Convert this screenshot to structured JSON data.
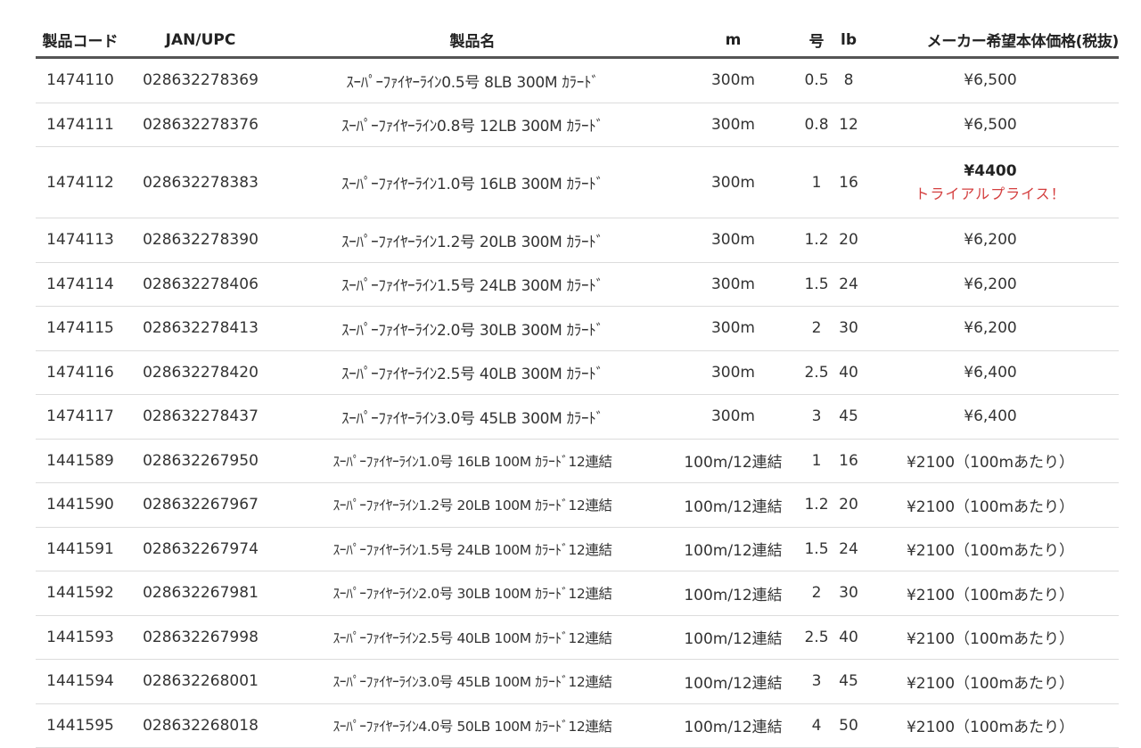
{
  "headers": {
    "code": "製品コード",
    "jan": "JAN/UPC",
    "name": "製品名",
    "m": "m",
    "go": "号",
    "lb": "lb",
    "price": "メーカー希望本体価格(税抜)"
  },
  "rows": [
    {
      "code": "1474110",
      "jan": "028632278369",
      "name": "ｽｰﾊﾟｰﾌｧｲﾔｰﾗｲﾝ0.5号 8LB 300M ｶﾗｰﾄﾞ",
      "m": "300m",
      "go": "0.5",
      "lb": "8",
      "price": "¥6,500"
    },
    {
      "code": "1474111",
      "jan": "028632278376",
      "name": "ｽｰﾊﾟｰﾌｧｲﾔｰﾗｲﾝ0.8号 12LB 300M ｶﾗｰﾄﾞ",
      "m": "300m",
      "go": "0.8",
      "lb": "12",
      "price": "¥6,500"
    },
    {
      "code": "1474112",
      "jan": "028632278383",
      "name": "ｽｰﾊﾟｰﾌｧｲﾔｰﾗｲﾝ1.0号 16LB 300M ｶﾗｰﾄﾞ",
      "m": "300m",
      "go": "1",
      "lb": "16",
      "price": "¥4400",
      "price_note": "トライアルプライス！"
    },
    {
      "code": "1474113",
      "jan": "028632278390",
      "name": "ｽｰﾊﾟｰﾌｧｲﾔｰﾗｲﾝ1.2号 20LB 300M ｶﾗｰﾄﾞ",
      "m": "300m",
      "go": "1.2",
      "lb": "20",
      "price": "¥6,200"
    },
    {
      "code": "1474114",
      "jan": "028632278406",
      "name": "ｽｰﾊﾟｰﾌｧｲﾔｰﾗｲﾝ1.5号 24LB 300M ｶﾗｰﾄﾞ",
      "m": "300m",
      "go": "1.5",
      "lb": "24",
      "price": "¥6,200"
    },
    {
      "code": "1474115",
      "jan": "028632278413",
      "name": "ｽｰﾊﾟｰﾌｧｲﾔｰﾗｲﾝ2.0号 30LB 300M ｶﾗｰﾄﾞ",
      "m": "300m",
      "go": "2",
      "lb": "30",
      "price": "¥6,200"
    },
    {
      "code": "1474116",
      "jan": "028632278420",
      "name": "ｽｰﾊﾟｰﾌｧｲﾔｰﾗｲﾝ2.5号 40LB 300M ｶﾗｰﾄﾞ",
      "m": "300m",
      "go": "2.5",
      "lb": "40",
      "price": "¥6,400"
    },
    {
      "code": "1474117",
      "jan": "028632278437",
      "name": "ｽｰﾊﾟｰﾌｧｲﾔｰﾗｲﾝ3.0号 45LB 300M ｶﾗｰﾄﾞ",
      "m": "300m",
      "go": "3",
      "lb": "45",
      "price": "¥6,400"
    },
    {
      "code": "1441589",
      "jan": "028632267950",
      "name": "ｽｰﾊﾟｰﾌｧｲﾔｰﾗｲﾝ1.0号 16LB 100M ｶﾗｰﾄﾞ12連結",
      "m": "100m/12連結",
      "go": "1",
      "lb": "16",
      "price": "¥2100（100mあたり）"
    },
    {
      "code": "1441590",
      "jan": "028632267967",
      "name": "ｽｰﾊﾟｰﾌｧｲﾔｰﾗｲﾝ1.2号 20LB 100M ｶﾗｰﾄﾞ12連結",
      "m": "100m/12連結",
      "go": "1.2",
      "lb": "20",
      "price": "¥2100（100mあたり）"
    },
    {
      "code": "1441591",
      "jan": "028632267974",
      "name": "ｽｰﾊﾟｰﾌｧｲﾔｰﾗｲﾝ1.5号 24LB 100M ｶﾗｰﾄﾞ12連結",
      "m": "100m/12連結",
      "go": "1.5",
      "lb": "24",
      "price": "¥2100（100mあたり）"
    },
    {
      "code": "1441592",
      "jan": "028632267981",
      "name": "ｽｰﾊﾟｰﾌｧｲﾔｰﾗｲﾝ2.0号 30LB 100M ｶﾗｰﾄﾞ12連結",
      "m": "100m/12連結",
      "go": "2",
      "lb": "30",
      "price": "¥2100（100mあたり）"
    },
    {
      "code": "1441593",
      "jan": "028632267998",
      "name": "ｽｰﾊﾟｰﾌｧｲﾔｰﾗｲﾝ2.5号 40LB 100M ｶﾗｰﾄﾞ12連結",
      "m": "100m/12連結",
      "go": "2.5",
      "lb": "40",
      "price": "¥2100（100mあたり）"
    },
    {
      "code": "1441594",
      "jan": "028632268001",
      "name": "ｽｰﾊﾟｰﾌｧｲﾔｰﾗｲﾝ3.0号 45LB 100M ｶﾗｰﾄﾞ12連結",
      "m": "100m/12連結",
      "go": "3",
      "lb": "45",
      "price": "¥2100（100mあたり）"
    },
    {
      "code": "1441595",
      "jan": "028632268018",
      "name": "ｽｰﾊﾟｰﾌｧｲﾔｰﾗｲﾝ4.0号 50LB 100M ｶﾗｰﾄﾞ12連結",
      "m": "100m/12連結",
      "go": "4",
      "lb": "50",
      "price": "¥2100（100mあたり）"
    }
  ],
  "colors": {
    "header_rule": "#555555",
    "row_rule": "#dcdcdc",
    "note": "#d43f3f",
    "text": "#333333"
  }
}
